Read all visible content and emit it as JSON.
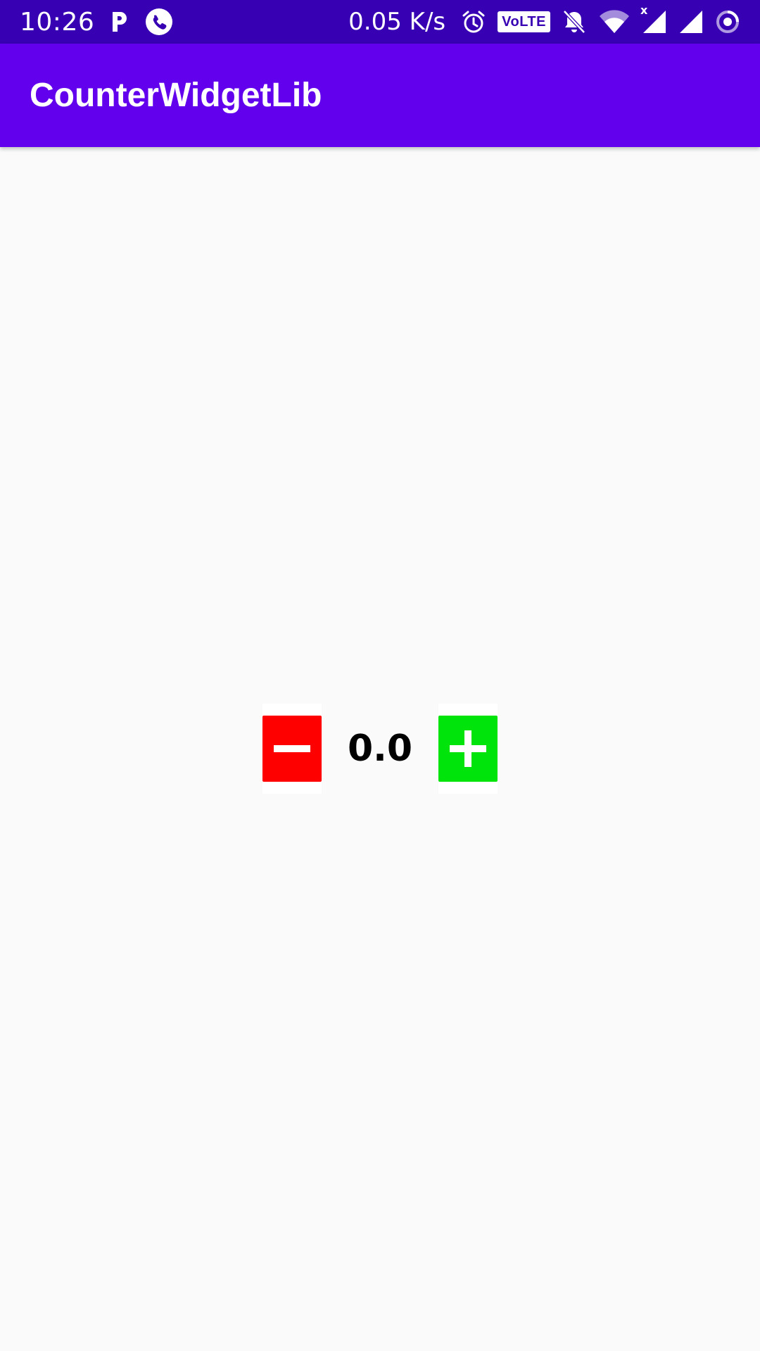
{
  "status_bar": {
    "time": "10:26",
    "network_speed": "0.05 K/s",
    "volte": "VoLTE",
    "signal_extra": "x",
    "icons": [
      "parking-icon",
      "phone-call-icon",
      "alarm-icon",
      "volte-icon",
      "bell-off-icon",
      "wifi-icon",
      "signal-icon",
      "signal-icon",
      "data-saver-icon"
    ]
  },
  "app_bar": {
    "title": "CounterWidgetLib",
    "color": "#6200EE"
  },
  "counter": {
    "value": "0.0",
    "decrement_color": "#FF0000",
    "increment_color": "#00E30B",
    "decrement_icon": "minus-icon",
    "increment_icon": "plus-icon"
  },
  "colors": {
    "status_bar": "#3700B3",
    "background": "#FAFAFA"
  }
}
